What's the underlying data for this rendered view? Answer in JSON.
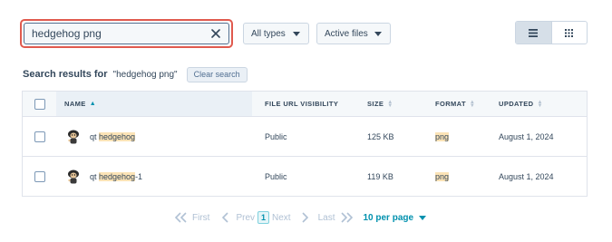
{
  "search": {
    "value": "hedgehog png",
    "placeholder": ""
  },
  "filters": {
    "type_label": "All types",
    "status_label": "Active files"
  },
  "view_toggle": {
    "active": "list",
    "icons": [
      "list-view-icon",
      "grid-view-icon"
    ]
  },
  "results": {
    "label": "Search results for",
    "query": "\"hedgehog png\"",
    "clear_label": "Clear search"
  },
  "table": {
    "columns": [
      "NAME",
      "FILE URL VISIBILITY",
      "SIZE",
      "FORMAT",
      "UPDATED"
    ],
    "rows": [
      {
        "name_prefix": "qt ",
        "name_match": "hedgehog",
        "name_suffix": "",
        "visibility": "Public",
        "size": "125 KB",
        "format": "png",
        "updated": "August 1, 2024"
      },
      {
        "name_prefix": "qt ",
        "name_match": "hedgehog",
        "name_suffix": "-1",
        "visibility": "Public",
        "size": "119 KB",
        "format": "png",
        "updated": "August 1, 2024"
      }
    ]
  },
  "pagination": {
    "first": "First",
    "prev": "Prev",
    "current": "1",
    "next": "Next",
    "last": "Last",
    "per_page": "10 per page"
  },
  "colors": {
    "accent": "#0091ae",
    "highlight": "#fbe3b6",
    "search_border": "#e05a4e"
  }
}
